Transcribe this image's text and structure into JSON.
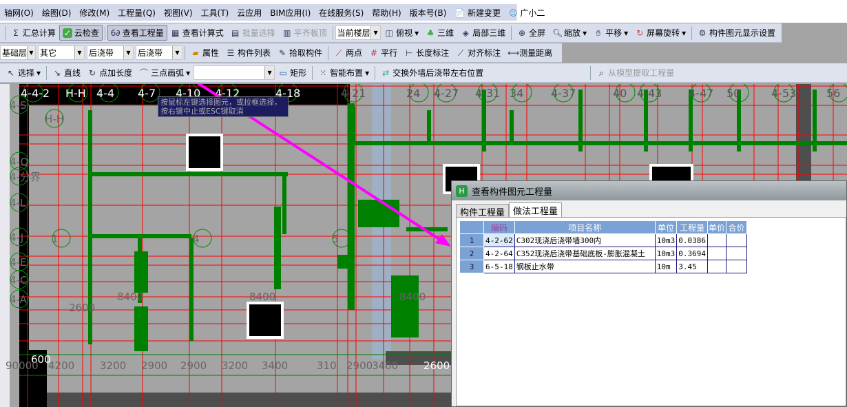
{
  "menu": [
    "轴网(O)",
    "绘图(D)",
    "修改(M)",
    "工程量(Q)",
    "视图(V)",
    "工具(T)",
    "云应用",
    "BIM应用(I)",
    "在线服务(S)",
    "帮助(H)",
    "版本号(B)"
  ],
  "menu_extra": {
    "new_change": "新建变更",
    "assistant": "广小二"
  },
  "toolbar1": {
    "sum": "汇总计算",
    "cloud_check": "云检查",
    "view_qty": "查看工程量",
    "view_formula": "查看计算式",
    "batch_select": "批量选择",
    "align_slab": "平齐板顶",
    "floor_select": "当前楼层",
    "top_view": "俯视",
    "3d": "三维",
    "local_3d": "局部三维",
    "fullscreen": "全屏",
    "zoom": "缩放",
    "pan": "平移",
    "rotate": "屏幕旋转",
    "display_settings": "构件图元显示设置"
  },
  "toolbar2": {
    "floor": "基础层",
    "category": "其它",
    "type": "后浇带",
    "name": "后浇带",
    "props": "属性",
    "list": "构件列表",
    "pick": "拾取构件",
    "two_point": "两点",
    "parallel": "平行",
    "length_dim": "长度标注",
    "align_dim": "对齐标注",
    "measure": "测量距离"
  },
  "toolbar3": {
    "select": "选择",
    "line": "直线",
    "point_len": "点加长度",
    "arc3": "三点画弧",
    "rect": "矩形",
    "smart": "智能布置",
    "swap": "交换外墙后浇带左右位置",
    "extract": "从模型提取工程量"
  },
  "tooltip": "按鼠标左键选择图元，或拉框选择，按右键中止或ESC键取消",
  "axes_top": [
    "4-4-2",
    "H-H",
    "4-4",
    "4-7",
    "4-10",
    "4-12",
    "4-18",
    "4-21",
    "24",
    "4-27",
    "4-31",
    "34",
    "4-37",
    "40",
    "4-43",
    "4-47",
    "50",
    "4-53",
    "56"
  ],
  "axes_left": [
    "4-S",
    "H-H",
    "4-Q",
    "4-分界",
    "1",
    "4-L",
    "4-J",
    "4-E",
    "4-C",
    "4-A",
    "4",
    "5"
  ],
  "dims": [
    "8400",
    "8400",
    "8400",
    "2600",
    "4200",
    "3200",
    "2900",
    "2900",
    "3200",
    "3400",
    "310",
    "2900",
    "3400",
    "2600",
    "600",
    "90000"
  ],
  "dialog": {
    "title": "查看构件图元工程量",
    "tabs": [
      "构件工程量",
      "做法工程量"
    ],
    "active_tab": 1,
    "columns": [
      "",
      "编码",
      "项目名称",
      "单位",
      "工程量",
      "单价",
      "合价"
    ],
    "rows": [
      {
        "n": "1",
        "code": "4-2-62",
        "name": "C302现浇后浇带墙300内",
        "unit": "10m3",
        "qty": "0.0386",
        "price": "",
        "total": ""
      },
      {
        "n": "2",
        "code": "4-2-64",
        "name": "C352现浇后浇带基础底板-膨胀混凝土",
        "unit": "10m3",
        "qty": "0.3694",
        "price": "",
        "total": ""
      },
      {
        "n": "3",
        "code": "6-5-18",
        "name": "钢板止水带",
        "unit": "10m",
        "qty": "3.45",
        "price": "",
        "total": ""
      }
    ]
  },
  "colors": {
    "grid_red": "#ff0000",
    "wall_green": "#008000",
    "axis_green": "#008000",
    "pointer": "#ff00ff",
    "header_blue": "#7ba2d4"
  }
}
